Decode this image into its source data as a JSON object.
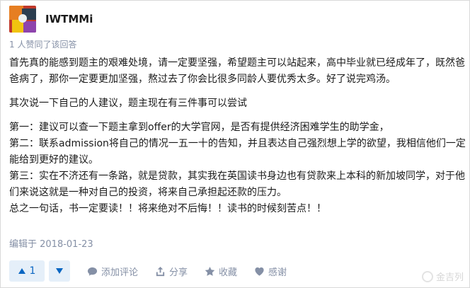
{
  "author": {
    "name": "IWTMMi"
  },
  "vote_summary": "1 人赞同了该回答",
  "paragraphs": {
    "p1": "首先真的能感到题主的艰难处境，请一定要坚强，希望题主可以站起来，高中毕业就已经成年了，既然爸爸病了，那你一定要更加坚强，熬过去了你会比很多同龄人要优秀太多。好了说完鸡汤。",
    "p2": "其次说一下自己的人建议，题主现在有三件事可以尝试",
    "p3": "第一：建议可以查一下题主拿到offer的大学官网，是否有提供经济困难学生的助学金，",
    "p4": "第二：联系admission将自己的情况一五一十的告知，并且表达自己强烈想上学的欲望，我相信他们一定能给到更好的建议。",
    "p5": "第三：实在不济还有一条路，就是贷款，其实我在英国读书身边也有贷款来上本科的新加坡同学，对于他们来说这就是一种对自己的投资，将来自己承担起还款的压力。",
    "p6": "总之一句话，书一定要读！！将来绝对不后悔！！读书的时候刻苦点！！"
  },
  "edit_time": "编辑于 2018-01-23",
  "actions": {
    "upvote_count": "1",
    "comment": "添加评论",
    "share": "分享",
    "collect": "收藏",
    "thanks": "感谢"
  },
  "watermark": "金吉列",
  "colors": {
    "accent": "#0a66c2",
    "accent_bg": "#e5eff9",
    "muted": "#8590a6"
  }
}
